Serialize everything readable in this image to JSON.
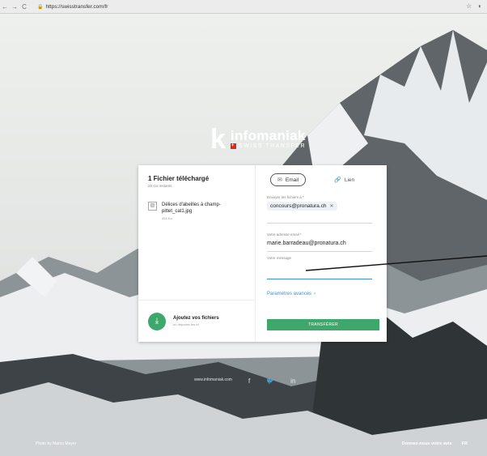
{
  "browser": {
    "url": "https://swisstransfer.com/fr",
    "back_glyph": "←",
    "forward_glyph": "→",
    "reload_glyph": "C",
    "star_glyph": "☆"
  },
  "logo": {
    "k": "k",
    "name": "infomaniak",
    "subtitle": "SWISS TRANSFER"
  },
  "upload_panel": {
    "title": "1 Fichier téléchargé",
    "subtitle": "25 Go restants",
    "file_name": "Délices d'abeilles à champ-pittet_cat1.jpg",
    "file_size": "454 Ko",
    "add_title": "Ajoutez vos fichiers",
    "add_subtitle": "ou déposez-les ici"
  },
  "form": {
    "tabs": [
      {
        "label": "Email",
        "icon": "envelope-icon"
      },
      {
        "label": "Lien",
        "icon": "link-icon"
      }
    ],
    "recipients_label": "Envoyer les fichiers à *",
    "recipient_chip": "concours@pronatura.ch",
    "sender_label": "Votre adresse email *",
    "sender_value": "marie.barradeau@pronatura.ch",
    "message_label": "Votre message",
    "advanced_link": "Paramètres avancés",
    "send_button": "TRANSFÉRER"
  },
  "footer": {
    "social_text": "www.infomaniak.com",
    "credit": "Photo by Marco Meyer",
    "feedback": "Donnez-nous votre avis",
    "language": "FR"
  },
  "colors": {
    "accent_green": "#3ea86c",
    "link_blue": "#3a92d8",
    "swiss_red": "#d52b1e"
  }
}
